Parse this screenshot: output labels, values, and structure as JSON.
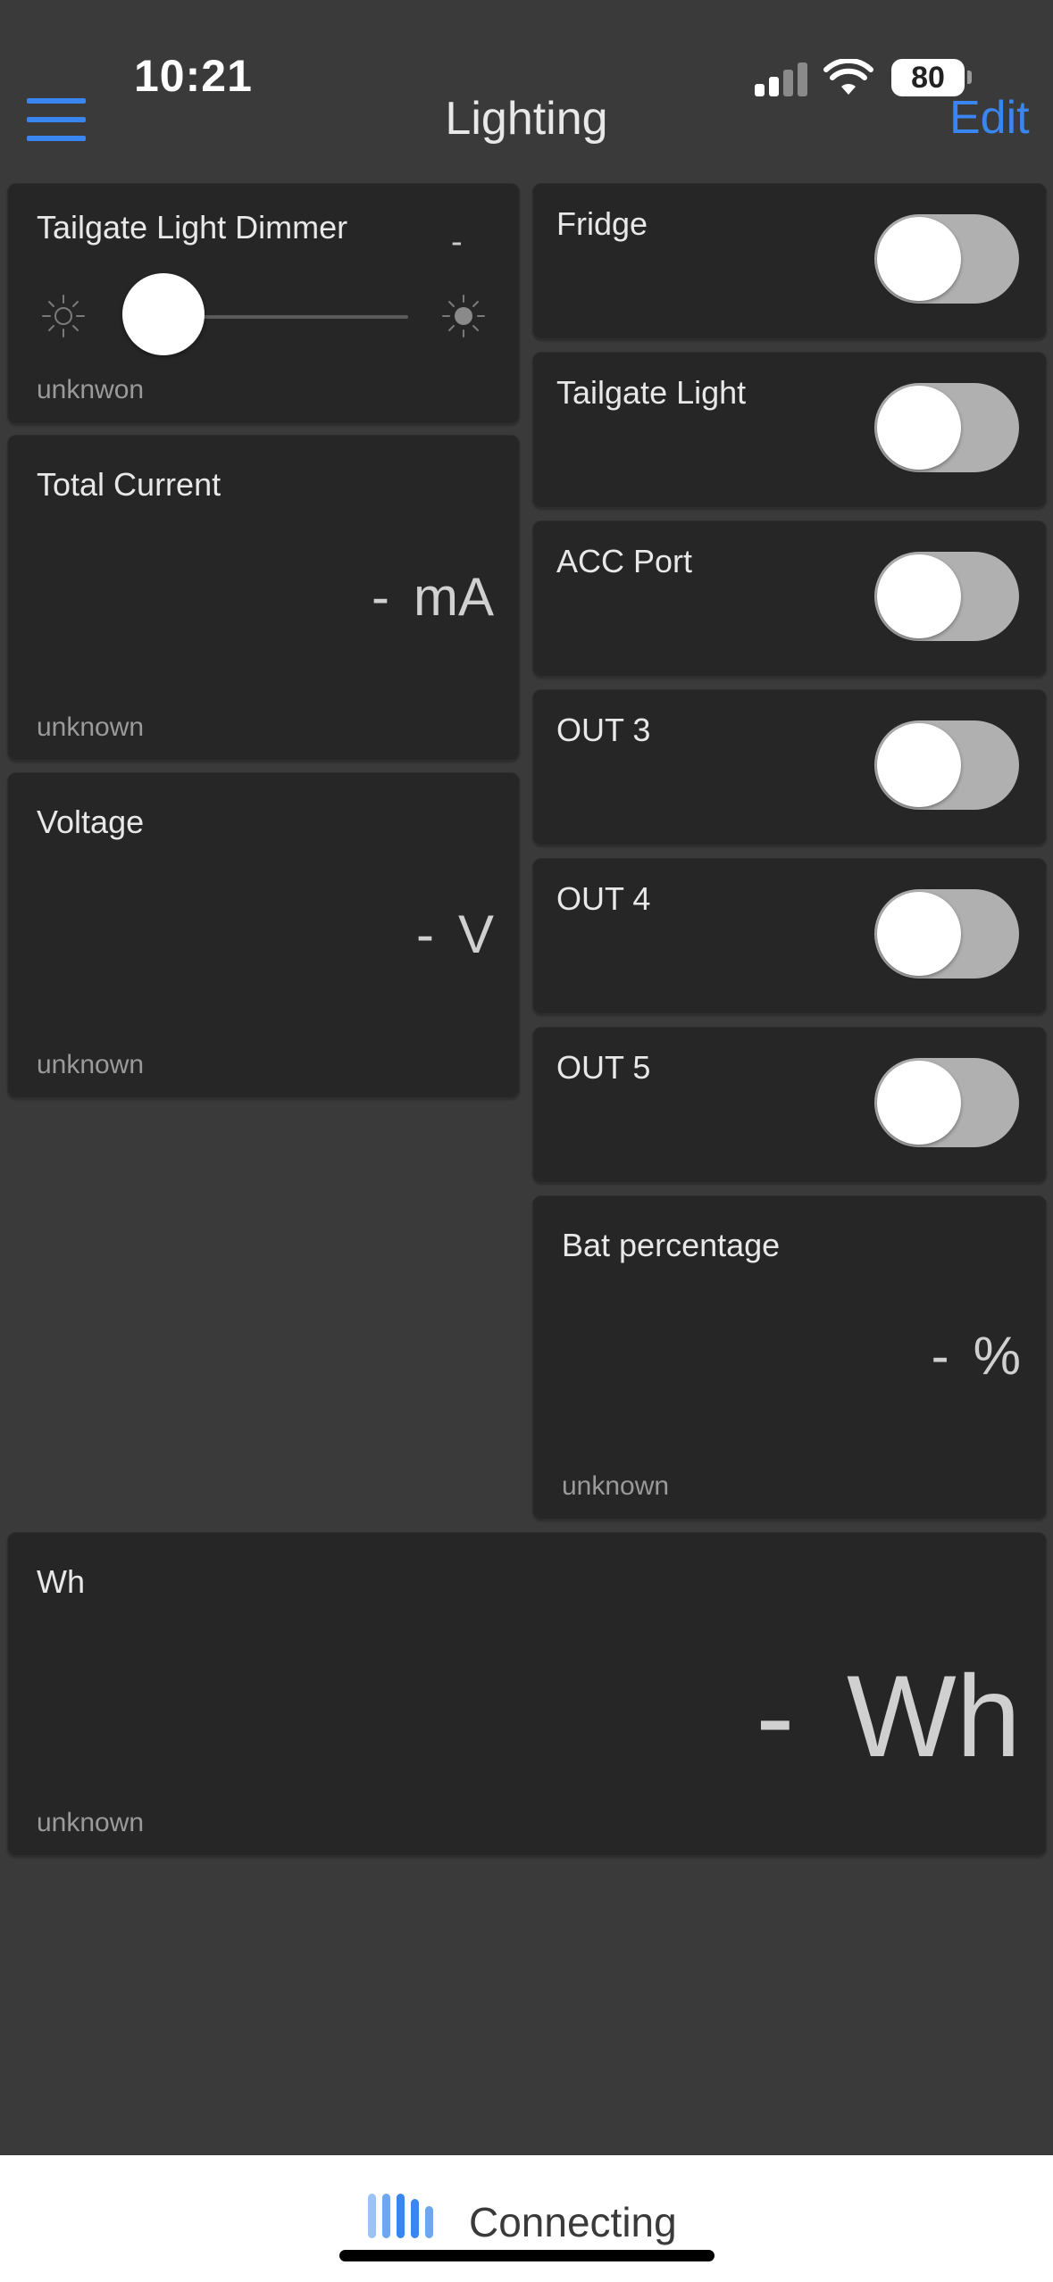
{
  "status_bar": {
    "time": "10:21",
    "battery": "80"
  },
  "nav": {
    "title": "Lighting",
    "edit_label": "Edit"
  },
  "dimmer": {
    "title": "Tailgate Light Dimmer",
    "value": "-",
    "status": "unknwon",
    "level": 0
  },
  "current": {
    "title": "Total Current",
    "dash": "-",
    "unit": "mA",
    "status": "unknown"
  },
  "voltage": {
    "title": "Voltage",
    "dash": "-",
    "unit": "V",
    "status": "unknown"
  },
  "switches": [
    {
      "label": "Fridge",
      "on": false
    },
    {
      "label": "Tailgate Light",
      "on": false
    },
    {
      "label": "ACC Port",
      "on": false
    },
    {
      "label": "OUT 3",
      "on": false
    },
    {
      "label": "OUT 4",
      "on": false
    },
    {
      "label": "OUT 5",
      "on": false
    }
  ],
  "bat": {
    "title": "Bat percentage",
    "dash": "-",
    "unit": "%",
    "status": "unknown"
  },
  "wh": {
    "title": "Wh",
    "dash": "-",
    "unit": "Wh",
    "status": "unknown"
  },
  "bottom": {
    "connection_label": "Connecting"
  },
  "colors": {
    "accent": "#3a86f0",
    "background": "#3a3a3a",
    "card": "#262626"
  }
}
